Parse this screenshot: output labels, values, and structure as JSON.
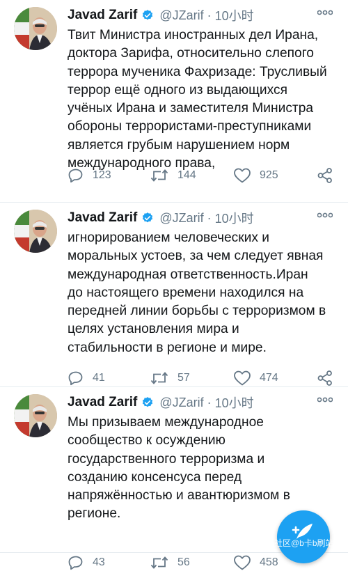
{
  "tweets": [
    {
      "author_name": "Javad Zarif",
      "handle": "@JZarif",
      "separator": "·",
      "time": "10小时",
      "text_lines": [
        "Твит Министра иностранных дел Ирана,",
        "доктора Зарифа, относительно слепого",
        "террора мученика Фахризаде: Трусливый",
        "террор ещё одного из выдающихся",
        "учёных Ирана и заместителя Министра",
        "обороны террористами-преступниками",
        "является грубым нарушением норм",
        "международного права,"
      ],
      "replies": "123",
      "retweets": "144",
      "likes": "925"
    },
    {
      "author_name": "Javad Zarif",
      "handle": "@JZarif",
      "separator": "·",
      "time": "10小时",
      "text_lines": [
        "игнорированием человеческих и",
        "моральных устоев, за чем следует явная",
        "международная ответственность.Иран",
        "до настоящего времени находился на",
        "передней линии борьбы с терроризмом в",
        "целях установления мира и",
        "стабильности в регионе и мире."
      ],
      "replies": "41",
      "retweets": "57",
      "likes": "474"
    },
    {
      "author_name": "Javad Zarif",
      "handle": "@JZarif",
      "separator": "·",
      "time": "10小时",
      "text_lines": [
        "Мы призываем международное",
        "сообщество к осуждению",
        "государственного терроризма и",
        "созданию консенсуса перед",
        "напряжённостью и авантюризмом в",
        "регионе."
      ],
      "replies": "43",
      "retweets": "56",
      "likes": "458"
    }
  ],
  "watermark": "社区@b卡b刷站",
  "icons": {
    "verified": "verified-badge-icon",
    "more": "more-options-icon",
    "reply": "reply-icon",
    "retweet": "retweet-icon",
    "like": "like-icon",
    "share": "share-icon",
    "compose": "compose-tweet-icon"
  },
  "colors": {
    "accent": "#1da1f2",
    "text": "#14171a",
    "secondary": "#657786"
  }
}
